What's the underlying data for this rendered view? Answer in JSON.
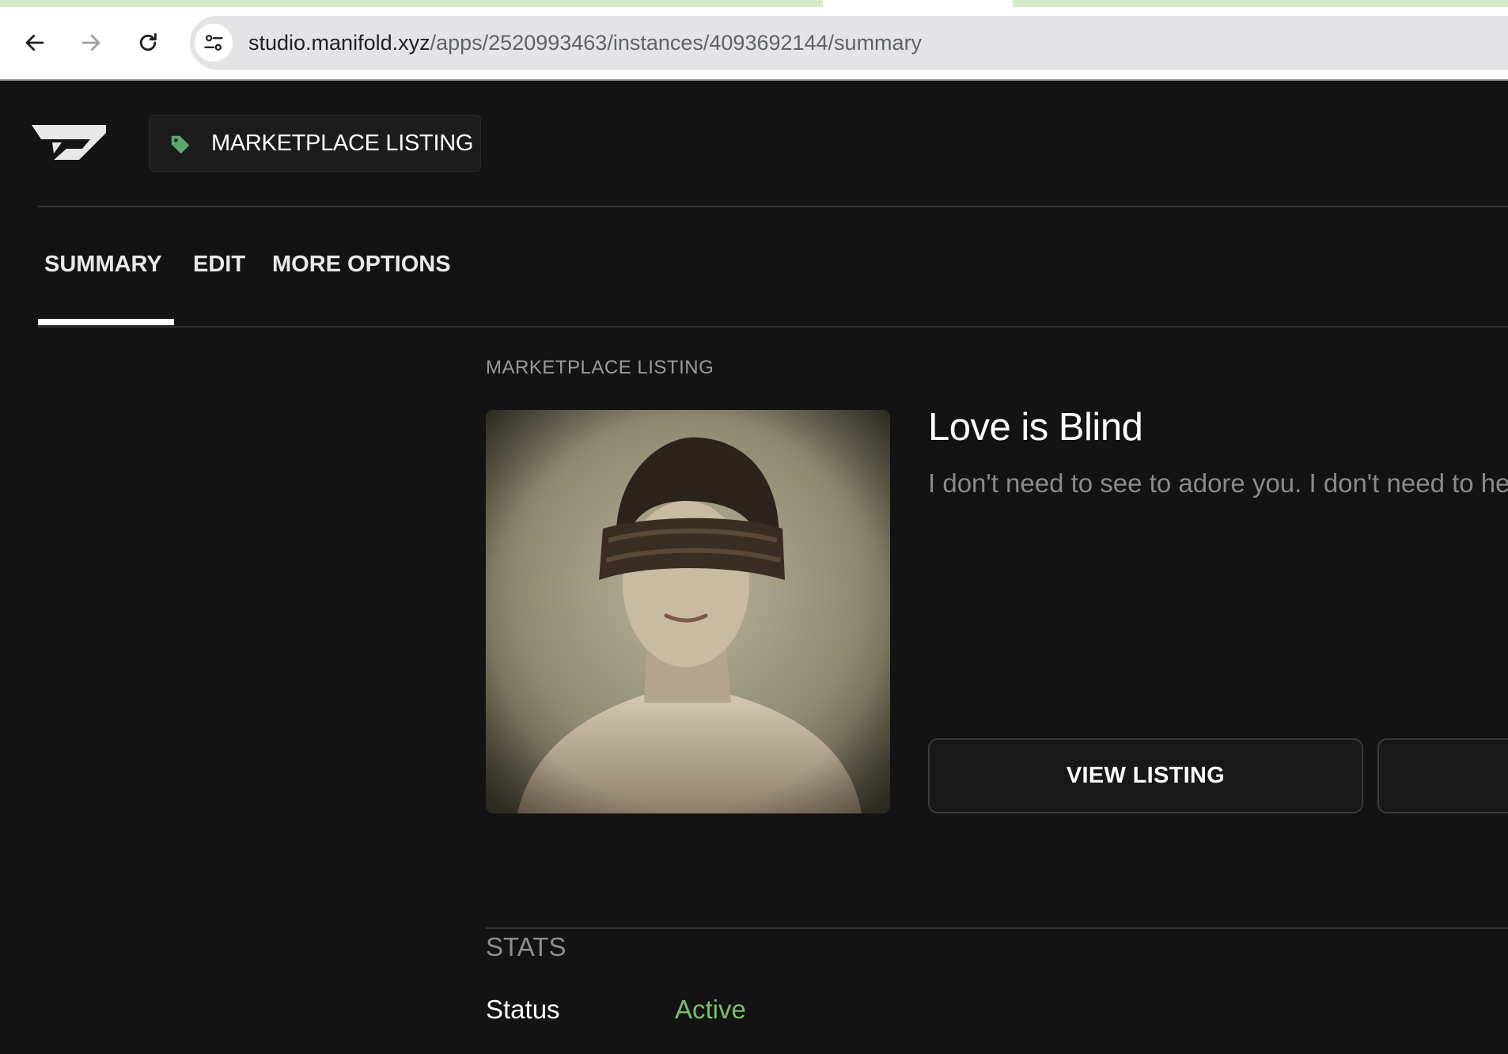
{
  "browser": {
    "url_host": "studio.manifold.xyz",
    "url_path": "/apps/2520993463/instances/4093692144/summary",
    "back_icon": "arrow-left-icon",
    "forward_icon": "arrow-right-icon",
    "reload_icon": "reload-icon",
    "site_info_icon": "tune-icon"
  },
  "header": {
    "logo_icon": "manifold-logo",
    "app_badge_label": "MARKETPLACE LISTING",
    "app_badge_icon": "tag-icon",
    "tag_color": "#5aa86a"
  },
  "tabs": [
    {
      "label": "SUMMARY",
      "active": true
    },
    {
      "label": "EDIT",
      "active": false
    },
    {
      "label": "MORE OPTIONS",
      "active": false
    }
  ],
  "content": {
    "section_label": "MARKETPLACE LISTING",
    "title": "Love is Blind",
    "description": "I don't need to see to adore you. I don't need to hea",
    "view_button_label": "VIEW LISTING",
    "stats_heading": "STATS",
    "stats": [
      {
        "label": "Status",
        "value": "Active",
        "color": "#7bbf6a"
      }
    ]
  }
}
